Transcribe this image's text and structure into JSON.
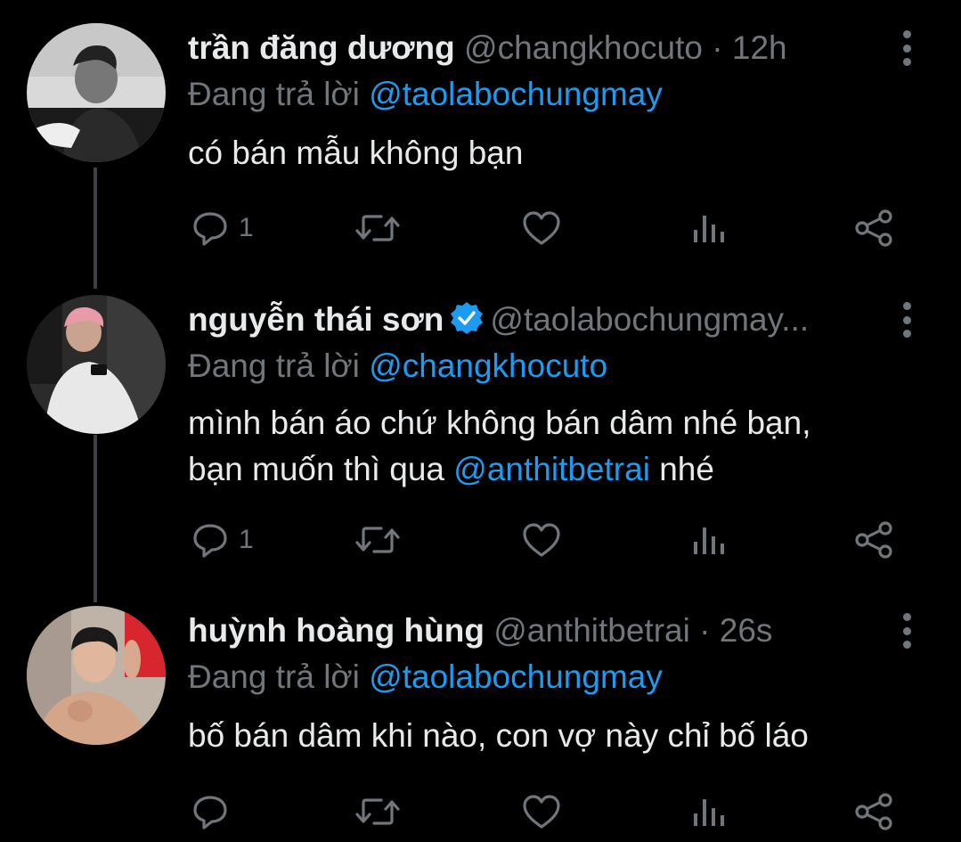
{
  "colors": {
    "background": "#000000",
    "primary_text": "#e7e9ea",
    "secondary_text": "#71767b",
    "accent": "#1d9bf0",
    "thread_line": "#3e4144"
  },
  "tweets": [
    {
      "name": "trần đăng dương",
      "handle": "@changkhocuto",
      "separator": "·",
      "time": "12h",
      "verified": false,
      "replying_label": "Đang trả lời",
      "replying_to": "@taolabochungmay",
      "body_lines": [
        "có bán mẫu không bạn"
      ],
      "reply_count": "1",
      "icons": [
        "reply-icon",
        "retweet-icon",
        "like-icon",
        "views-icon",
        "share-icon"
      ]
    },
    {
      "name": "nguyễn thái sơn",
      "handle": "@taolabochungmay...",
      "verified": true,
      "replying_label": "Đang trả lời",
      "replying_to": "@changkhocuto",
      "body_line1": "mình bán áo chứ không bán dâm nhé bạn,",
      "body_line2_prefix": "bạn muốn thì qua",
      "body_line2_mention": "@anthitbetrai",
      "body_line2_suffix": "nhé",
      "reply_count": "1"
    },
    {
      "name": "huỳnh hoàng hùng",
      "handle": "@anthitbetrai",
      "separator": "·",
      "time": "26s",
      "verified": false,
      "replying_label": "Đang trả lời",
      "replying_to": "@taolabochungmay",
      "body_lines": [
        "bố bán dâm khi nào, con vợ này chỉ bố láo"
      ],
      "reply_count": ""
    }
  ]
}
